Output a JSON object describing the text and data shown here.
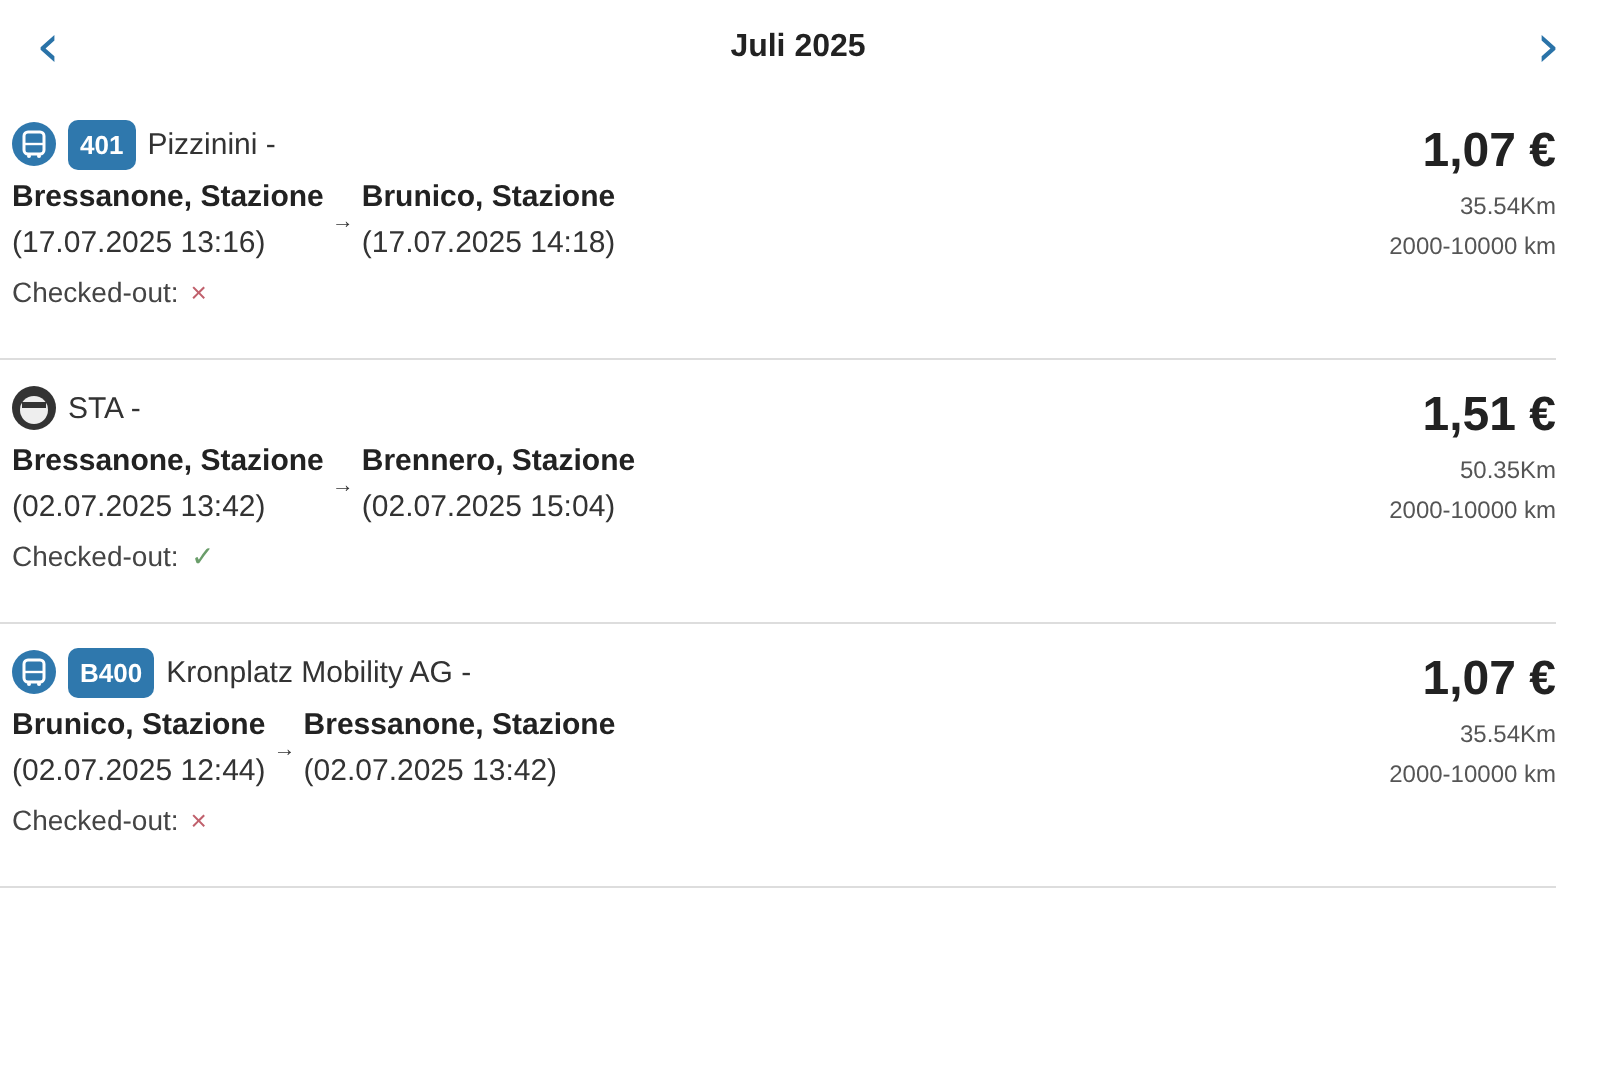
{
  "header": {
    "prev": "‹",
    "title": "Juli 2025",
    "next": "›"
  },
  "trips": [
    {
      "kind": "bus",
      "route": "401",
      "operator": "Pizzinini -",
      "from": "Bressanone, Stazione",
      "from_time": "(17.07.2025 13:16)",
      "arrow": "→",
      "to": "Brunico, Stazione",
      "to_time": "(17.07.2025 14:18)",
      "checked_label": "Checked-out:",
      "checked_out": false,
      "mark": "×",
      "price": "1,07 €",
      "distance": "35.54Km",
      "band": "2000-10000 km"
    },
    {
      "kind": "operator",
      "operator": "STA -",
      "from": "Bressanone, Stazione",
      "from_time": "(02.07.2025 13:42)",
      "arrow": "→",
      "to": "Brennero, Stazione",
      "to_time": "(02.07.2025 15:04)",
      "checked_label": "Checked-out:",
      "checked_out": true,
      "mark": "✓",
      "price": "1,51 €",
      "distance": "50.35Km",
      "band": "2000-10000 km"
    },
    {
      "kind": "bus",
      "route": "B400",
      "operator": "Kronplatz Mobility AG -",
      "from": "Brunico, Stazione",
      "from_time": "(02.07.2025 12:44)",
      "arrow": "→",
      "to": "Bressanone, Stazione",
      "to_time": "(02.07.2025 13:42)",
      "checked_label": "Checked-out:",
      "checked_out": false,
      "mark": "×",
      "price": "1,07 €",
      "distance": "35.54Km",
      "band": "2000-10000 km"
    }
  ]
}
